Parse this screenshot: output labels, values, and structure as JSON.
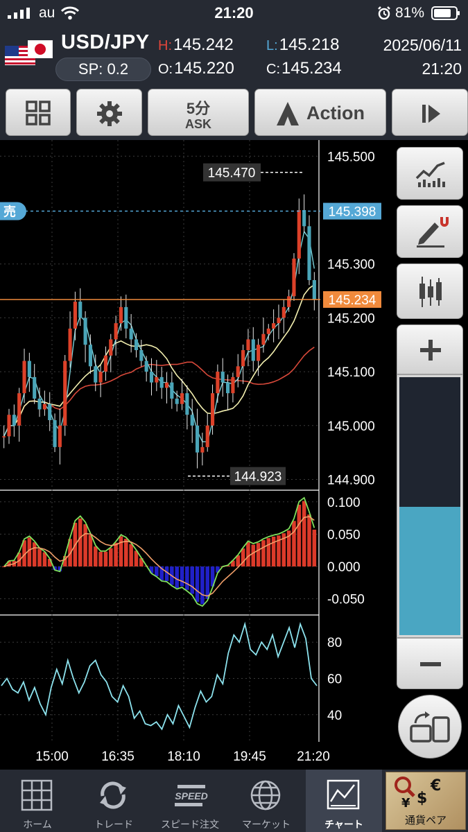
{
  "status_bar": {
    "carrier": "au",
    "time": "21:20",
    "battery": "81%"
  },
  "header": {
    "symbol": "USD/JPY",
    "spread": "SP: 0.2",
    "high_label": "H:",
    "high": "145.242",
    "low_label": "L:",
    "low": "145.218",
    "open_label": "O:",
    "open": "145.220",
    "close_label": "C:",
    "close": "145.234",
    "date": "2025/06/11",
    "time": "21:20"
  },
  "toolbar": {
    "timeframe": "5分",
    "price_type": "ASK",
    "action_label": "Action"
  },
  "chart": {
    "sell_tag": "売",
    "icons": [
      "grid-icon",
      "gear-icon",
      "action-icon",
      "play-icon",
      "chart-type-icon",
      "drawing-icon",
      "candlestick-icon",
      "plus-icon",
      "minus-icon",
      "rotate-icon"
    ]
  },
  "chart_data": [
    {
      "type": "candlestick",
      "y_ticks": [
        "145.500",
        "145.300",
        "145.200",
        "145.100",
        "145.000",
        "144.900"
      ],
      "ylim": [
        144.88,
        145.53
      ],
      "x_ticks": [
        "15:00",
        "16:35",
        "18:10",
        "19:45",
        "21:20"
      ],
      "annotations": {
        "high": "145.470",
        "low": "144.923",
        "sell_price": "145.398",
        "current_price": "145.234"
      },
      "close_series": [
        144.98,
        145.02,
        145.0,
        145.06,
        145.12,
        145.09,
        145.05,
        145.03,
        145.04,
        145.01,
        144.96,
        145.0,
        145.12,
        145.18,
        145.23,
        145.2,
        145.15,
        145.11,
        145.08,
        145.1,
        145.13,
        145.16,
        145.19,
        145.22,
        145.18,
        145.16,
        145.14,
        145.12,
        145.1,
        145.08,
        145.09,
        145.07,
        145.08,
        145.05,
        145.04,
        145.06,
        145.02,
        145.0,
        144.95,
        144.96,
        145.0,
        145.06,
        145.1,
        145.08,
        145.06,
        145.09,
        145.11,
        145.14,
        145.16,
        145.12,
        145.15,
        145.17,
        145.18,
        145.19,
        145.2,
        145.22,
        145.24,
        145.31,
        145.4,
        145.37,
        145.27,
        145.234
      ],
      "lines": [
        "yellow-ma",
        "red-ma",
        "teal-ma"
      ]
    },
    {
      "type": "histogram",
      "y_ticks": [
        "0.100",
        "0.050",
        "0.000",
        "-0.050"
      ],
      "ylim": [
        -0.075,
        0.118
      ],
      "lines": [
        "green-signal",
        "orange-signal"
      ]
    },
    {
      "type": "line",
      "y_ticks": [
        "80",
        "60",
        "40"
      ],
      "ylim": [
        25,
        95
      ],
      "series": [
        {
          "values": [
            56,
            60,
            54,
            52,
            58,
            48,
            55,
            46,
            40,
            55,
            65,
            57,
            70,
            60,
            52,
            58,
            67,
            70,
            62,
            58,
            50,
            47,
            56,
            50,
            38,
            42,
            35,
            34,
            36,
            32,
            40,
            35,
            45,
            39,
            33,
            44,
            53,
            47,
            50,
            62,
            57,
            74,
            84,
            80,
            90,
            76,
            73,
            80,
            76,
            84,
            72,
            80,
            88,
            77,
            90,
            82,
            60,
            56
          ]
        }
      ]
    }
  ],
  "nav": {
    "items": [
      {
        "label": "ホーム",
        "name": "home"
      },
      {
        "label": "トレード",
        "name": "trade"
      },
      {
        "label": "スピード注文",
        "name": "speed-order"
      },
      {
        "label": "マーケット",
        "name": "market"
      },
      {
        "label": "チャート",
        "name": "chart"
      },
      {
        "label": "通貨ペア",
        "name": "currency-pair"
      }
    ],
    "speed_icon_text": "SPEED"
  },
  "colors": {
    "up": "#dc4129",
    "down": "#4aa5b8",
    "sell": "#55a8d6",
    "current": "#f08a3c",
    "hist_pos": "#dc3a2a",
    "hist_neg": "#2020c8",
    "rsi": "#8de3ee"
  }
}
